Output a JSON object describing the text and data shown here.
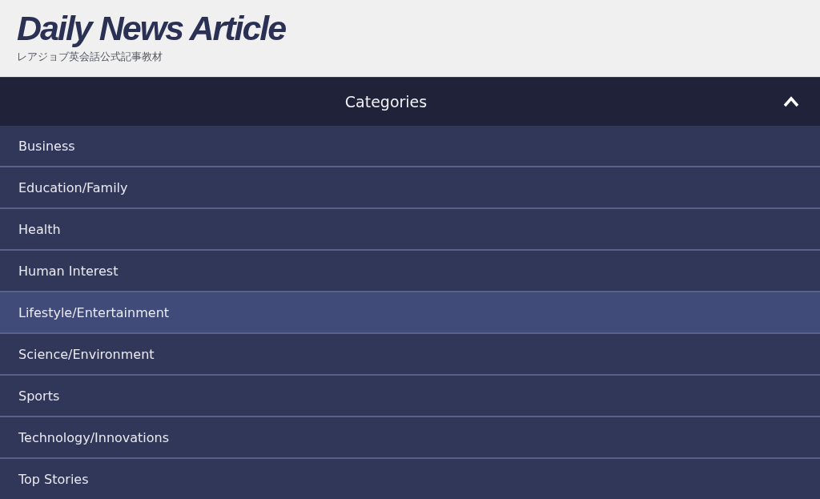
{
  "header": {
    "title": "Daily News Article",
    "subtitle": "レアジョブ英会話公式記事教材"
  },
  "categories": {
    "title": "Categories",
    "expanded": true,
    "items": [
      {
        "label": "Business",
        "selected": false
      },
      {
        "label": "Education/Family",
        "selected": false
      },
      {
        "label": "Health",
        "selected": false
      },
      {
        "label": "Human Interest",
        "selected": false
      },
      {
        "label": "Lifestyle/Entertainment",
        "selected": true
      },
      {
        "label": "Science/Environment",
        "selected": false
      },
      {
        "label": "Sports",
        "selected": false
      },
      {
        "label": "Technology/Innovations",
        "selected": false
      },
      {
        "label": "Top Stories",
        "selected": false
      }
    ]
  }
}
